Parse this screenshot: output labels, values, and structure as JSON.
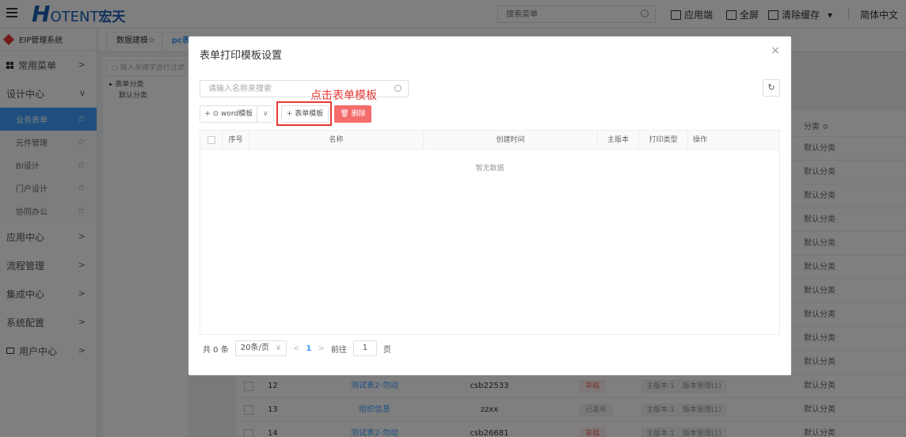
{
  "header": {
    "logo_h": "H",
    "logo_rest": "OTENT",
    "logo_cn": "宏天",
    "search_placeholder": "搜索菜单",
    "app_label": "应用端",
    "fullscreen_label": "全屏",
    "clear_cache_label": "清除缓存",
    "clear_cache_caret": "▾",
    "language": "简体中文"
  },
  "sidebar": {
    "system_title": "EIP管理系统",
    "common_menu": "常用菜单",
    "design_center": "设计中心",
    "design_items": [
      {
        "label": "业务表单",
        "active": true
      },
      {
        "label": "元件管理"
      },
      {
        "label": "BI设计"
      },
      {
        "label": "门户设计"
      },
      {
        "label": "协同办公"
      }
    ],
    "app_center": "应用中心",
    "process_mgmt": "流程管理",
    "integration_center": "集成中心",
    "system_config": "系统配置",
    "user_center": "用户中心",
    "arrow_right": ">",
    "arrow_down": "∨",
    "star": "☆"
  },
  "background": {
    "tabs": [
      "数据建模☆",
      "pc表"
    ],
    "tree_search": "输入关键字进行过滤",
    "tree_root": "表单分类",
    "tree_child": "默认分类",
    "col_category": "分类",
    "category_value": "默认分类",
    "rows": [
      {
        "no": "12",
        "name": "测试表2-勿动",
        "code": "csb22533",
        "status": "草稿",
        "main_ver": "主版本:1",
        "ver_mgmt": "版本管理(1)"
      },
      {
        "no": "13",
        "name": "组织信息",
        "code": "zzxx",
        "status": "已发布",
        "main_ver": "主版本:1",
        "ver_mgmt": "版本管理(1)"
      },
      {
        "no": "14",
        "name": "测试表2-勿动",
        "code": "csb26681",
        "status": "草稿",
        "main_ver": "主版本:1",
        "ver_mgmt": "版本管理(1)"
      }
    ]
  },
  "dialog": {
    "title": "表单打印模板设置",
    "close": "×",
    "search_placeholder": "请输入名称来搜索",
    "refresh": "↻",
    "annotation": "点击表单模板",
    "word_button": "+ ⊙ word模板",
    "word_dropdown": "∨",
    "form_button": "+ 表单模板",
    "delete_button": "🗑 删除",
    "columns": [
      "序号",
      "名称",
      "创建时间",
      "主版本",
      "打印类型",
      "操作"
    ],
    "empty_text": "暂无数据",
    "pager": {
      "total": "共 0 条",
      "page_size": "20条/页",
      "page_size_caret": "∨",
      "prev": "<",
      "page": "1",
      "next": ">",
      "goto_label": "前往",
      "goto_value": "1",
      "page_suffix": "页"
    }
  }
}
